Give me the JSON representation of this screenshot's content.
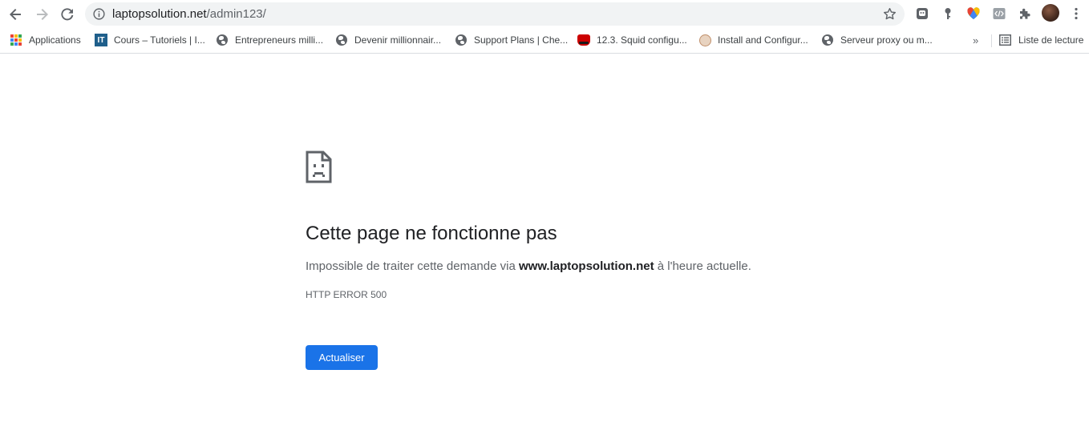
{
  "browser": {
    "url": {
      "host": "laptopsolution.net",
      "path": "/admin123/"
    }
  },
  "bookmarks": {
    "items": [
      {
        "label": "Applications",
        "icon": "apps-grid-icon"
      },
      {
        "label": "Cours – Tutoriels | I...",
        "icon": "it-connect-logo-icon"
      },
      {
        "label": "Entrepreneurs milli...",
        "icon": "globe-icon"
      },
      {
        "label": "Devenir millionnair...",
        "icon": "globe-icon"
      },
      {
        "label": "Support Plans | Che...",
        "icon": "globe-icon"
      },
      {
        "label": "12.3. Squid configu...",
        "icon": "redhat-logo-icon"
      },
      {
        "label": "Install and Configur...",
        "icon": "site-logo-icon"
      },
      {
        "label": "Serveur proxy ou m...",
        "icon": "globe-icon"
      }
    ],
    "more": "»",
    "reading_list": "Liste de lecture"
  },
  "error_page": {
    "title": "Cette page ne fonctionne pas",
    "message_prefix": "Impossible de traiter cette demande via ",
    "message_host": "www.laptopsolution.net",
    "message_suffix": " à l'heure actuelle.",
    "code": "HTTP ERROR 500",
    "reload_label": "Actualiser"
  },
  "colors": {
    "accent": "#1a73e8",
    "omnibox_bg": "#f1f3f4",
    "text_primary": "#202124",
    "text_secondary": "#5f6368"
  }
}
